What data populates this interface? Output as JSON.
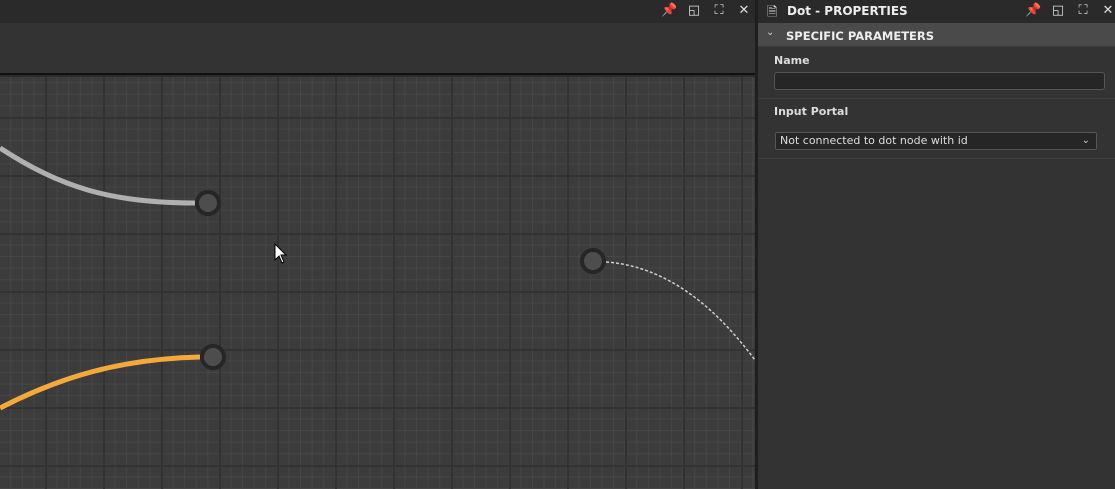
{
  "left_panel": {
    "icons": [
      "pin-icon",
      "dock-icon",
      "maximize-icon",
      "close-icon"
    ]
  },
  "properties": {
    "title": "Dot - PROPERTIES",
    "section": "SPECIFIC PARAMETERS",
    "name_label": "Name",
    "name_value": "",
    "input_portal_label": "Input Portal",
    "input_portal_value": "Not connected to dot node with id"
  },
  "colors": {
    "wire_gray": "#b0b0b0",
    "wire_orange": "#f5a93a",
    "wire_dashed": "#cfcfcf",
    "port_fill": "#4d4d4d",
    "port_ring": "#262626"
  }
}
